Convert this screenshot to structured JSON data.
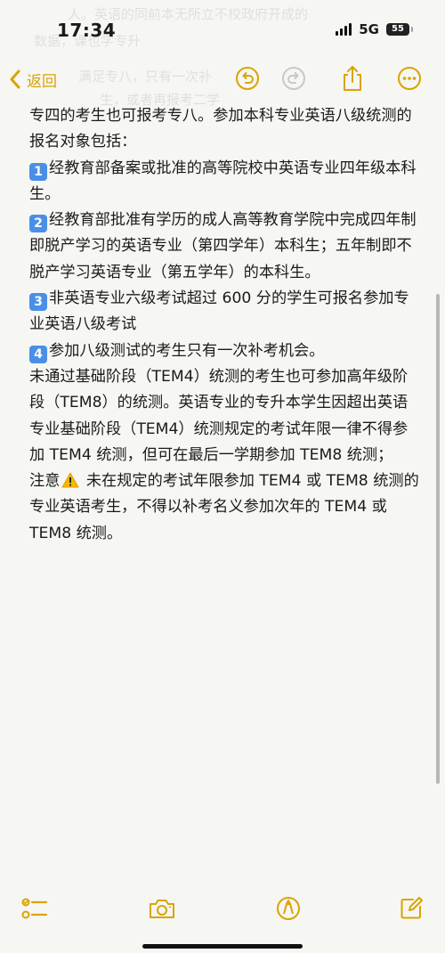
{
  "status": {
    "time": "17:34",
    "network": "5G",
    "battery": "55"
  },
  "nav": {
    "back_label": "返回"
  },
  "ghost": {
    "line1": "人。英语的同前本无所立不校政府开成的",
    "line2": "数据，课也学专升",
    "line3": "满足专八，只有一次补",
    "line4": "生，或者再报考二学"
  },
  "note": {
    "p1": "专四的考生也可报考专八。参加本科专业英语八级统测的报名对象包括：",
    "item1_num": "1",
    "item1": "经教育部备案或批准的高等院校中英语专业四年级本科生。",
    "item2_num": "2",
    "item2": "经教育部批准有学历的成人高等教育学院中完成四年制即脱产学习的英语专业（第四学年）本科生；五年制即不脱产学习英语专业（第五学年）的本科生。",
    "item3_num": "3",
    "item3": "非英语专业六级考试超过 600 分的学生可报名参加专业英语八级考试",
    "item4_num": "4",
    "item4": "参加八级测试的考生只有一次补考机会。",
    "p2": "未通过基础阶段（TEM4）统测的考生也可参加高年级阶段（TEM8）的统测。英语专业的专升本学生因超出英语专业基础阶段（TEM4）统测规定的考试年限一律不得参加 TEM4 统测，但可在最后一学期参加 TEM8 统测；",
    "note_label": "注意",
    "note_text": " 未在规定的考试年限参加 TEM4 或 TEM8 统测的专业英语考生，不得以补考名义参加次年的 TEM4 或 TEM8 统测。"
  },
  "colors": {
    "accent": "#d9a400",
    "badge": "#4a8fe7",
    "background": "#f6f6f3"
  },
  "icons": [
    "chevron-left-icon",
    "undo-icon",
    "redo-icon",
    "share-icon",
    "more-icon",
    "checklist-icon",
    "camera-icon",
    "markup-icon",
    "compose-icon",
    "warning-icon"
  ]
}
